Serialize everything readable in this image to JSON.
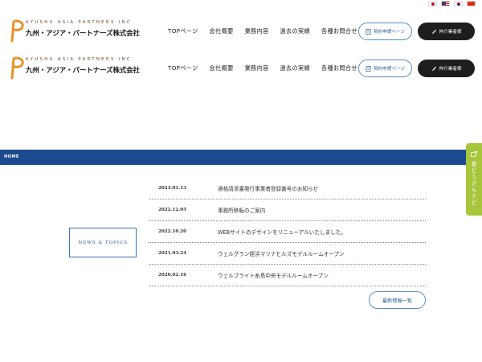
{
  "languages": [
    {
      "name": "japanese",
      "icon": "flag-jp-icon"
    },
    {
      "name": "english",
      "icon": "flag-us-icon"
    },
    {
      "name": "korean",
      "icon": "flag-kr-icon"
    },
    {
      "name": "chinese",
      "icon": "flag-cn-icon"
    }
  ],
  "header": {
    "logo_en": "KYUSHU ASIA PARTNERS INC.",
    "logo_jp": "九州・アジア・パートナーズ株式会社",
    "nav": [
      "TOPページ",
      "会社概要",
      "業務内容",
      "過去の実績",
      "各種お問合せ"
    ],
    "contract_button": "契約申請ページ",
    "agent_button": "仲介業者様"
  },
  "breadcrumb": {
    "home": "HOME"
  },
  "side_tab": {
    "label": "食どうさんナビ"
  },
  "news": {
    "heading": "NEWS & TOPICS",
    "items": [
      {
        "date": "2023.01.13",
        "title": "適格請求書発行事業者登録番号のお知らせ"
      },
      {
        "date": "2022.12.05",
        "title": "事務所移転のご案内"
      },
      {
        "date": "2022.10.20",
        "title": "WEBサイトのデザインをリニューアルいたしました。"
      },
      {
        "date": "2021.03.24",
        "title": "ウェルグラン姪浜マリナヒルズモデルルームオープン"
      },
      {
        "date": "2020.02.16",
        "title": "ウェルブライト糸島中央モデルルームオープン"
      }
    ],
    "more_label": "最新情報一覧"
  },
  "colors": {
    "brand_blue": "#1b4a8f",
    "accent_blue": "#3a74b5",
    "side_tab_green": "#a7c63b",
    "dark_button": "#1e1e1e",
    "logo_orange": "#e8922a"
  }
}
